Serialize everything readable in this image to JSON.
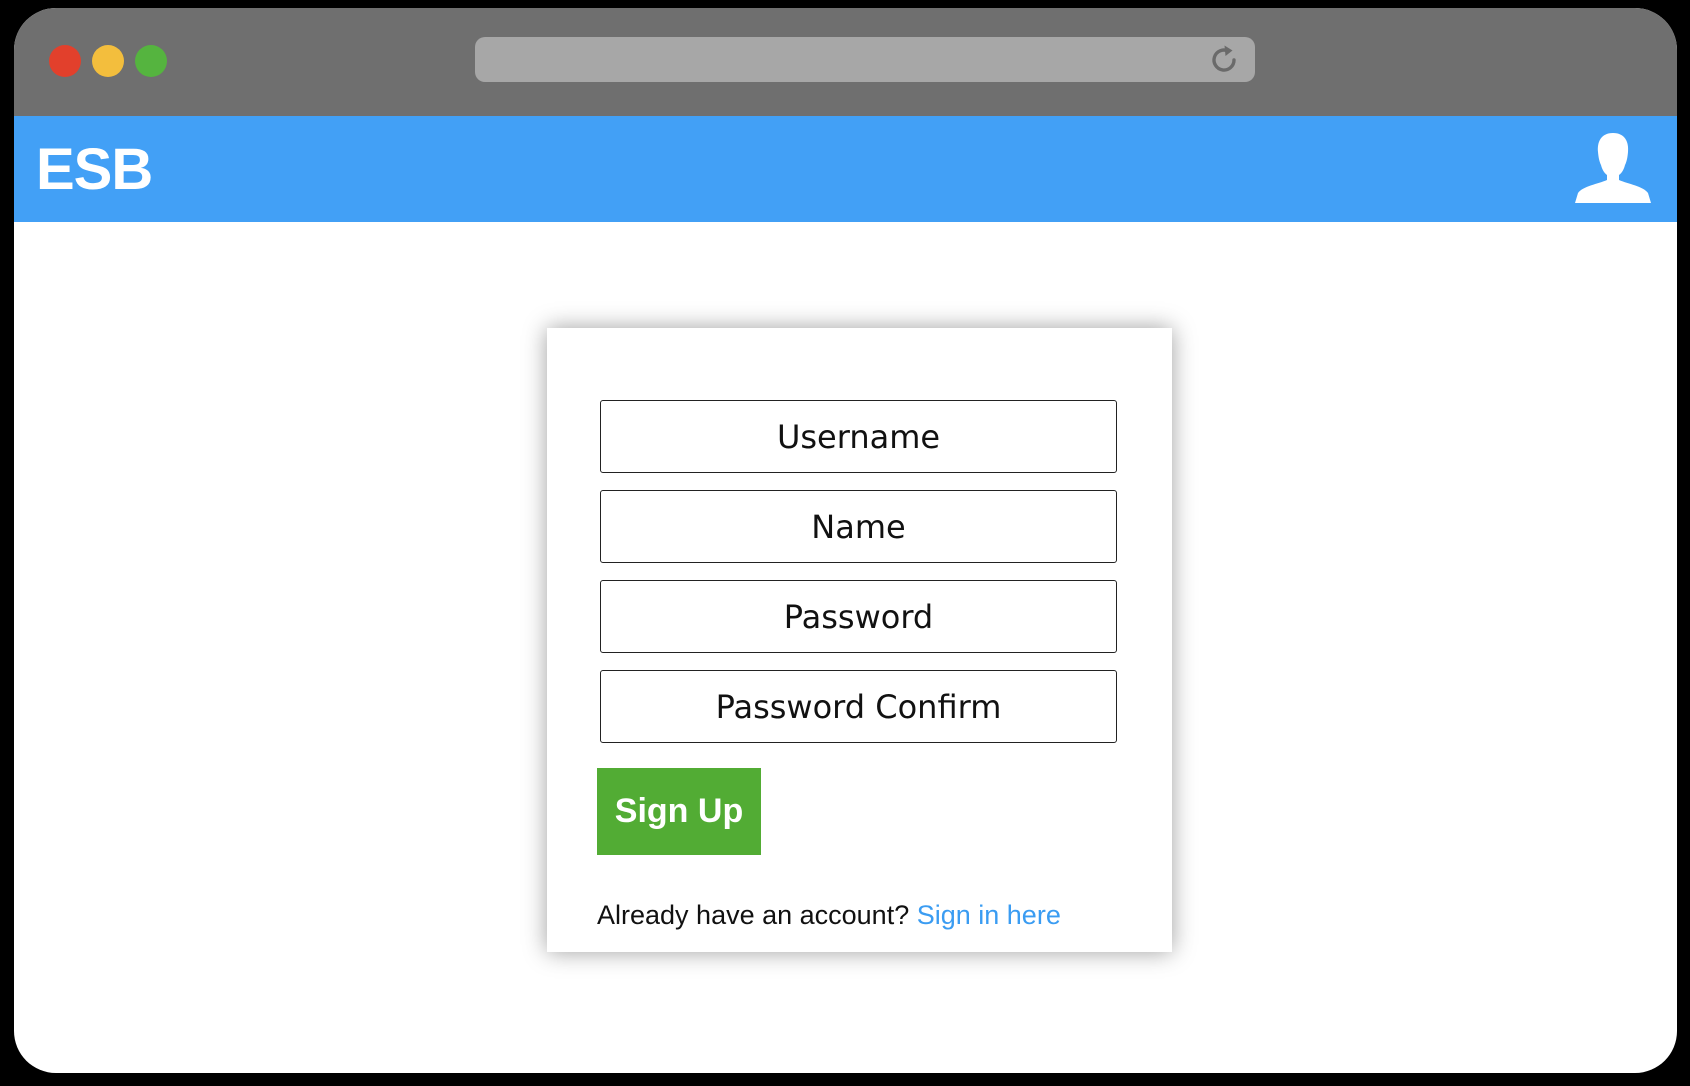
{
  "colors": {
    "titlebar": "#6f6f6f",
    "urlbar": "#a7a7a7",
    "appbar": "#42a0f6",
    "close": "#e2402c",
    "minimize": "#f3be3d",
    "maximize": "#55b43f",
    "signup_button": "#52ac34",
    "link": "#3a9cf2"
  },
  "browser": {
    "reload_icon": "reload-icon"
  },
  "header": {
    "brand": "ESB",
    "profile_icon": "user-silhouette-icon"
  },
  "form": {
    "username_placeholder": "Username",
    "name_placeholder": "Name",
    "password_placeholder": "Password",
    "password_confirm_placeholder": "Password Confirm",
    "signup_label": "Sign Up",
    "signin_prompt": "Already have an account?",
    "signin_link": "Sign in here"
  }
}
